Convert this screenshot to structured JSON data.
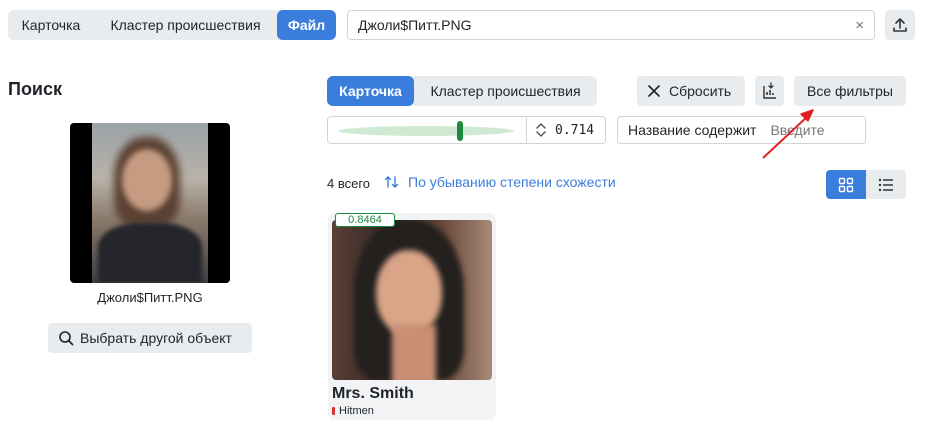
{
  "top_tabs": [
    {
      "label": "Карточка",
      "active": false
    },
    {
      "label": "Кластер происшествия",
      "active": false
    },
    {
      "label": "Файл",
      "active": true
    }
  ],
  "file_input": {
    "value": "Джоли$Питт.PNG",
    "clear": "×"
  },
  "search": {
    "title": "Поиск",
    "query_name": "Джоли$Питт.PNG",
    "choose_other_label": "Выбрать другой объект"
  },
  "results_tabs": [
    {
      "label": "Карточка",
      "active": true
    },
    {
      "label": "Кластер происшествия",
      "active": false
    }
  ],
  "toolbar": {
    "reset_label": "Сбросить",
    "all_filters_label": "Все фильтры"
  },
  "similarity": {
    "value": "0.714",
    "level": 0.714
  },
  "name_filter": {
    "label": "Название содержит",
    "placeholder": "Введите"
  },
  "results": {
    "count": "4 всего",
    "sort_label": "По убыванию степени схожести",
    "view_mode": "grid"
  },
  "cards": [
    {
      "score": "0.8464",
      "title": "Mrs. Smith",
      "tag": "Hitmen"
    }
  ],
  "colors": {
    "accent": "#3b7ddd",
    "score_green": "#1e8a3d",
    "tag_red": "#d9342b",
    "annotation_arrow": "#e02020"
  }
}
